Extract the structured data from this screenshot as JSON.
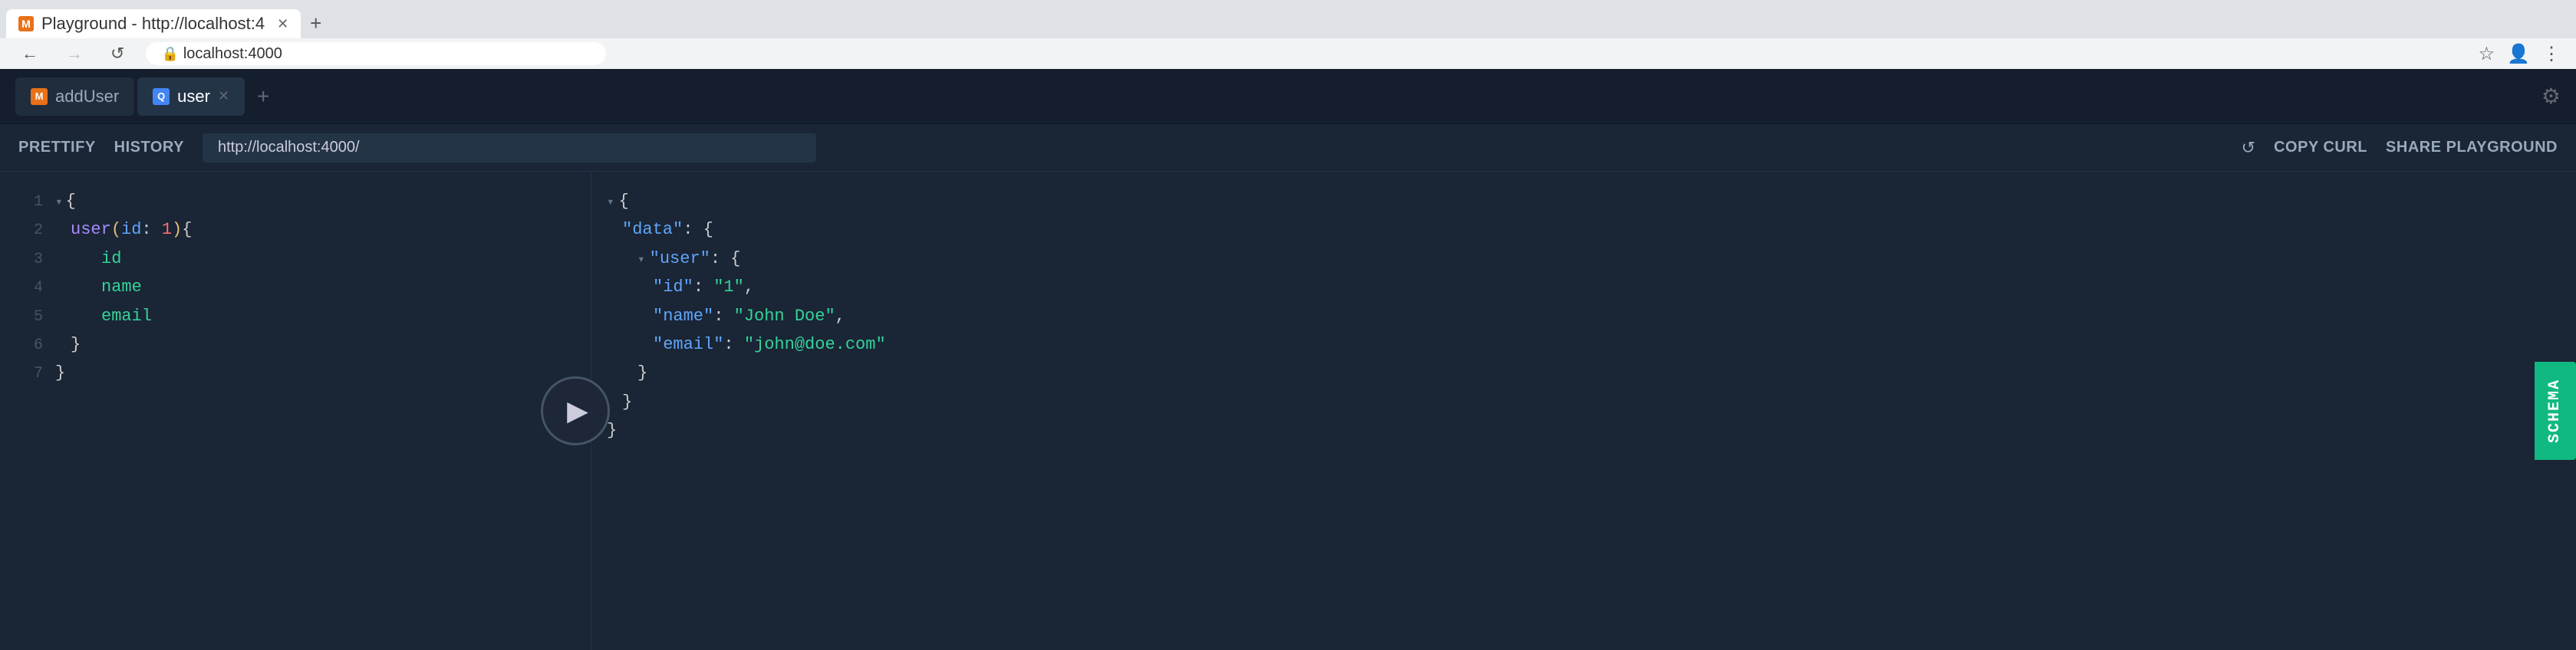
{
  "browser": {
    "tabs": [
      {
        "id": "tab-playground",
        "favicon_type": "orange",
        "favicon_label": "M",
        "label": "Playground - http://localhost:4",
        "closable": false,
        "active": false
      },
      {
        "id": "tab-new",
        "label": "+",
        "is_new": true
      }
    ],
    "address": "localhost:4000",
    "new_tab_label": "+",
    "back_disabled": false,
    "forward_disabled": true
  },
  "app": {
    "tabs": [
      {
        "id": "addUser",
        "favicon_type": "orange",
        "favicon_label": "M",
        "label": "addUser",
        "closable": false,
        "active": false
      },
      {
        "id": "user",
        "favicon_type": "blue",
        "favicon_label": "Q",
        "label": "user",
        "closable": true,
        "active": true
      }
    ],
    "new_tab_label": "+",
    "settings_label": "⚙"
  },
  "toolbar": {
    "prettify_label": "PRETTIFY",
    "history_label": "HISTORY",
    "url_value": "http://localhost:4000/",
    "url_placeholder": "http://localhost:4000/",
    "copy_curl_label": "COPY CURL",
    "share_playground_label": "SHARE PLAYGROUND",
    "refresh_icon": "↺"
  },
  "query_editor": {
    "lines": [
      {
        "num": "1",
        "content": "▾ {"
      },
      {
        "num": "2",
        "content": "  user(id: 1){"
      },
      {
        "num": "3",
        "content": "    id"
      },
      {
        "num": "4",
        "content": "    name"
      },
      {
        "num": "5",
        "content": "    email"
      },
      {
        "num": "6",
        "content": "  }"
      },
      {
        "num": "7",
        "content": "}"
      }
    ]
  },
  "result": {
    "lines": [
      {
        "indent": 0,
        "content": "▾ {"
      },
      {
        "indent": 1,
        "content": "\"data\": {"
      },
      {
        "indent": 2,
        "content": "▾ \"user\": {"
      },
      {
        "indent": 3,
        "content": "\"id\": \"1\","
      },
      {
        "indent": 3,
        "content": "\"name\": \"John Doe\","
      },
      {
        "indent": 3,
        "content": "\"email\": \"john@doe.com\""
      },
      {
        "indent": 2,
        "content": "}"
      },
      {
        "indent": 1,
        "content": "}"
      },
      {
        "indent": 0,
        "content": "}"
      }
    ]
  },
  "schema_tab": {
    "label": "SCHEMA"
  },
  "colors": {
    "accent_green": "#10b981",
    "bg_dark": "#1a2535",
    "bg_darker": "#151e2d"
  }
}
